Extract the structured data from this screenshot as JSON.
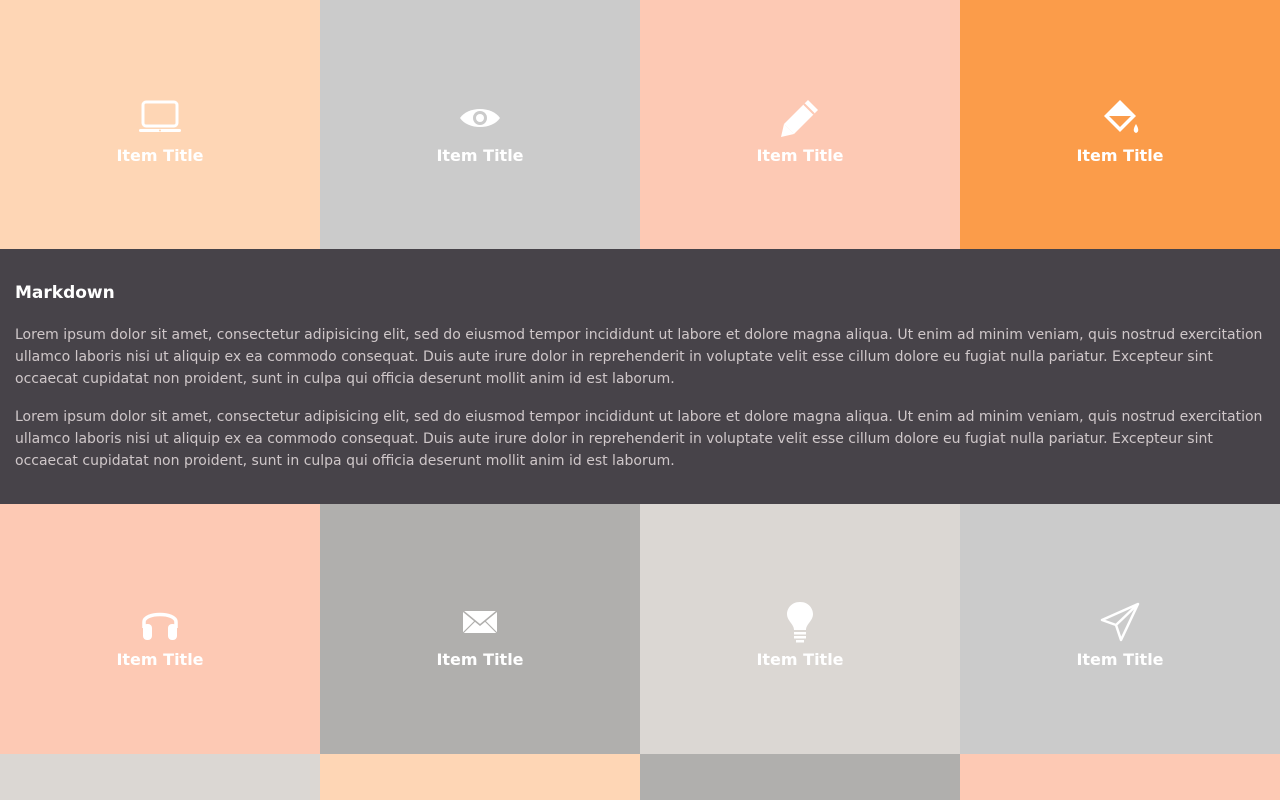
{
  "colors": {
    "peach_light": "#fed6b5",
    "gray_light": "#cbcbcb",
    "salmon": "#fdc9b4",
    "orange": "#fb9c4a",
    "gray_mid": "#b0afad",
    "stone": "#dbd7d3",
    "panel_bg": "#474349",
    "panel_text": "#cfc7c9"
  },
  "top_tiles": [
    {
      "title": "Item Title",
      "icon": "laptop-icon",
      "color": "#fed6b5"
    },
    {
      "title": "Item Title",
      "icon": "eye-icon",
      "color": "#cbcbcb"
    },
    {
      "title": "Item Title",
      "icon": "pencil-icon",
      "color": "#fdc9b4"
    },
    {
      "title": "Item Title",
      "icon": "paint-bucket-icon",
      "color": "#fb9c4a"
    }
  ],
  "panel": {
    "heading": "Markdown",
    "paragraphs": [
      "Lorem ipsum dolor sit amet, consectetur adipisicing elit, sed do eiusmod tempor incididunt ut labore et dolore magna aliqua. Ut enim ad minim veniam, quis nostrud exercitation ullamco laboris nisi ut aliquip ex ea commodo consequat. Duis aute irure dolor in reprehenderit in voluptate velit esse cillum dolore eu fugiat nulla pariatur. Excepteur sint occaecat cupidatat non proident, sunt in culpa qui officia deserunt mollit anim id est laborum.",
      "Lorem ipsum dolor sit amet, consectetur adipisicing elit, sed do eiusmod tempor incididunt ut labore et dolore magna aliqua. Ut enim ad minim veniam, quis nostrud exercitation ullamco laboris nisi ut aliquip ex ea commodo consequat. Duis aute irure dolor in reprehenderit in voluptate velit esse cillum dolore eu fugiat nulla pariatur. Excepteur sint occaecat cupidatat non proident, sunt in culpa qui officia deserunt mollit anim id est laborum."
    ]
  },
  "middle_tiles": [
    {
      "title": "Item Title",
      "icon": "headphones-icon",
      "color": "#fdc9b4"
    },
    {
      "title": "Item Title",
      "icon": "envelope-icon",
      "color": "#b0afad"
    },
    {
      "title": "Item Title",
      "icon": "lightbulb-icon",
      "color": "#dbd7d3"
    },
    {
      "title": "Item Title",
      "icon": "paper-plane-icon",
      "color": "#cbcbcb"
    }
  ],
  "bottom_tiles": [
    {
      "color": "#dbd7d3"
    },
    {
      "color": "#fed6b5"
    },
    {
      "color": "#b0afad"
    },
    {
      "color": "#fdc9b4"
    }
  ]
}
